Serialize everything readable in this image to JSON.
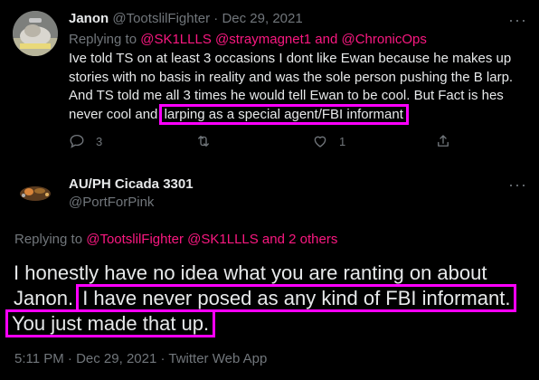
{
  "colors": {
    "background": "#000000",
    "text": "#e7e9ea",
    "muted": "#71767b",
    "accent_link": "#f91880",
    "highlight_box": "#ff00ff"
  },
  "reply_tweet": {
    "author_name": "Janon",
    "handle_date": "@TootslilFighter · Dec 29, 2021",
    "more_label": "···",
    "replying_to_prefix": "Replying to",
    "replying_to_links": "@SK1LLLS @straymagnet1 and @ChronicOps",
    "body_lines": [
      "Ive told TS on at least 3 occasions I dont like Ewan because he makes up",
      "stories with no basis in reality and was the sole person pushing the B larp.",
      "And TS told me all 3 times he would tell Ewan to be cool. But Fact is hes"
    ],
    "body_last_prefix": "never cool and ",
    "body_highlight": "larping as a special agent/FBI informant",
    "actions": {
      "reply_icon": "reply-icon",
      "reply_count": "3",
      "retweet_icon": "retweet-icon",
      "like_icon": "heart-icon",
      "like_count": "1",
      "share_icon": "share-icon"
    }
  },
  "main_tweet": {
    "author_name": "AU/PH Cicada 3301",
    "handle": "@PortForPink",
    "more_label": "···",
    "replying_to_prefix": "Replying to",
    "replying_to_links": "@TootslilFighter @SK1LLLS and 2 others",
    "text_line1": "I honestly have no idea what you are ranting on about",
    "text_line2_prefix": "Janon.",
    "text_highlight_1": "I have never posed as any kind of FBI informant.",
    "text_highlight_2": "You just made that up.",
    "meta": "5:11 PM · Dec 29, 2021 · Twitter Web App"
  }
}
